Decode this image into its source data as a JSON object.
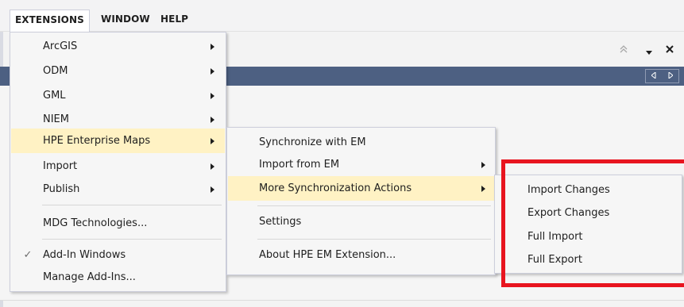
{
  "menubar": {
    "items": [
      "EXTENSIONS",
      "WINDOW",
      "HELP"
    ]
  },
  "panel": {
    "collapse_icon": "double-chevron-up-icon",
    "dropdown_icon": "triangle-down-icon",
    "close_icon": "close-icon",
    "nav_prev_icon": "triangle-left-icon",
    "nav_next_icon": "triangle-right-icon"
  },
  "extensions_menu": {
    "items": [
      {
        "label": "ArcGIS"
      },
      {
        "label": "ODM"
      },
      {
        "label": "GML"
      },
      {
        "label": "NIEM"
      },
      {
        "label": "HPE Enterprise Maps"
      },
      {
        "label": "Import"
      },
      {
        "label": "Publish"
      },
      {
        "label": "MDG Technologies..."
      },
      {
        "label": "Add-In Windows"
      },
      {
        "label": "Manage Add-Ins..."
      }
    ]
  },
  "hpe_menu": {
    "items": [
      {
        "label": "Synchronize with EM"
      },
      {
        "label": "Import from EM"
      },
      {
        "label": "More Synchronization Actions"
      },
      {
        "label": "Settings"
      },
      {
        "label": "About HPE EM Extension..."
      }
    ]
  },
  "sync_menu": {
    "items": [
      {
        "label": "Import Changes"
      },
      {
        "label": "Export Changes"
      },
      {
        "label": "Full Import"
      },
      {
        "label": "Full Export"
      }
    ]
  },
  "colors": {
    "highlight": "#fff2c4",
    "annotation_red": "#e8151f",
    "title_bar_blue": "#4d6082"
  }
}
